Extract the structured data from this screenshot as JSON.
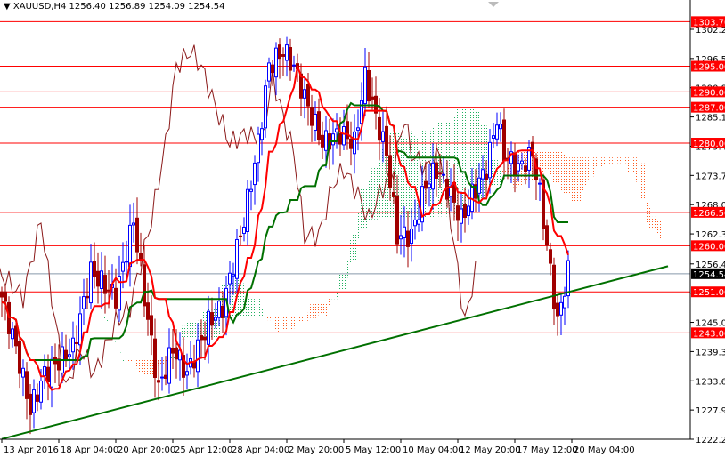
{
  "header": {
    "symbol": "XAUUSD,H4",
    "open": "1256.40",
    "high": "1256.89",
    "low": "1254.09",
    "close": "1254.54"
  },
  "chart_data": {
    "type": "candlestick",
    "title": "XAUUSD,H4",
    "timeframe": "H4",
    "ylim": [
      1222.25,
      1302.2
    ],
    "y_ticks": [
      "1302.20",
      "1296.50",
      "1290.80",
      "1285.10",
      "1279.40",
      "1273.70",
      "1268.00",
      "1262.30",
      "1256.45",
      "1250.75",
      "1245.05",
      "1239.35",
      "1233.65",
      "1227.95",
      "1222.25"
    ],
    "x_ticks": [
      {
        "bar": 0,
        "label": "13 Apr 2016"
      },
      {
        "bar": 16,
        "label": "18 Apr 04:00"
      },
      {
        "bar": 32,
        "label": "20 Apr 20:00"
      },
      {
        "bar": 48,
        "label": "25 Apr 12:00"
      },
      {
        "bar": 64,
        "label": "28 Apr 04:00"
      },
      {
        "bar": 80,
        "label": "2 May 20:00"
      },
      {
        "bar": 96,
        "label": "5 May 12:00"
      },
      {
        "bar": 112,
        "label": "10 May 04:00"
      },
      {
        "bar": 128,
        "label": "12 May 20:00"
      },
      {
        "bar": 144,
        "label": "17 May 12:00"
      },
      {
        "bar": 160,
        "label": "20 May 04:00"
      }
    ],
    "close_anchors": [
      [
        0,
        1250
      ],
      [
        4,
        1240
      ],
      [
        8,
        1228
      ],
      [
        12,
        1235
      ],
      [
        20,
        1240
      ],
      [
        25,
        1255
      ],
      [
        32,
        1250
      ],
      [
        37,
        1265
      ],
      [
        40,
        1250
      ],
      [
        44,
        1232
      ],
      [
        48,
        1240
      ],
      [
        52,
        1235
      ],
      [
        58,
        1245
      ],
      [
        62,
        1248
      ],
      [
        68,
        1265
      ],
      [
        72,
        1280
      ],
      [
        75,
        1295
      ],
      [
        79,
        1298
      ],
      [
        82,
        1295
      ],
      [
        86,
        1287
      ],
      [
        90,
        1280
      ],
      [
        95,
        1282
      ],
      [
        99,
        1280
      ],
      [
        102,
        1293
      ],
      [
        105,
        1285
      ],
      [
        108,
        1278
      ],
      [
        111,
        1262
      ],
      [
        115,
        1262
      ],
      [
        119,
        1272
      ],
      [
        122,
        1275
      ],
      [
        126,
        1270
      ],
      [
        129,
        1265
      ],
      [
        132,
        1270
      ],
      [
        136,
        1275
      ],
      [
        139,
        1285
      ],
      [
        141,
        1278
      ],
      [
        145,
        1275
      ],
      [
        149,
        1278
      ],
      [
        151,
        1270
      ],
      [
        154,
        1255
      ],
      [
        156,
        1245
      ],
      [
        158,
        1252
      ],
      [
        159,
        1255
      ]
    ],
    "levels": [
      {
        "price": 1303.7,
        "label": "1303.70"
      },
      {
        "price": 1295.0,
        "label": "1295.00"
      },
      {
        "price": 1290.0,
        "label": "1290.00"
      },
      {
        "price": 1287.0,
        "label": "1287.00"
      },
      {
        "price": 1280.0,
        "label": "1280.00"
      },
      {
        "price": 1266.5,
        "label": "1266.50"
      },
      {
        "price": 1260.0,
        "label": "1260.00"
      },
      {
        "price": 1251.0,
        "label": "1251.00"
      },
      {
        "price": 1243.0,
        "label": "1243.00"
      }
    ],
    "current_price": {
      "price": 1254.54,
      "label": "1254.54"
    },
    "trendline": {
      "from": [
        0,
        1222.3
      ],
      "to": [
        187,
        1256.0
      ]
    },
    "indicator": "Ichimoku (9,26,52)",
    "colors": {
      "up": "#0000ff",
      "down": "#a00000",
      "tenkan": "#ff0000",
      "kijun": "#007000",
      "chikou": "#8b1a1a",
      "level": "#ff0000",
      "cloud_up": "#20b060",
      "cloud_down": "#ff5a1e",
      "trend": "#007000"
    }
  }
}
